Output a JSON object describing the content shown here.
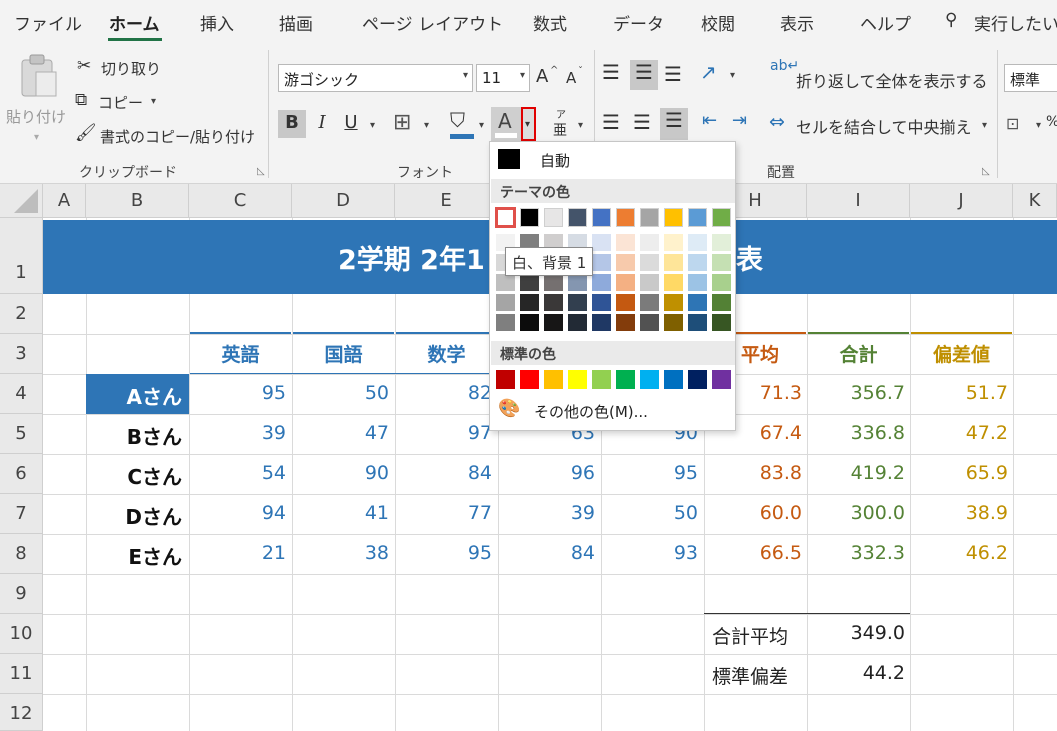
{
  "ribbon_tabs": [
    "ファイル",
    "ホーム",
    "挿入",
    "描画",
    "ページ レイアウト",
    "数式",
    "データ",
    "校閲",
    "表示",
    "ヘルプ"
  ],
  "search_label": "実行したい",
  "clipboard": {
    "paste": "貼り付け",
    "cut": "切り取り",
    "copy": "コピー",
    "format_painter": "書式のコピー/貼り付け",
    "group": "クリップボード"
  },
  "font": {
    "name": "游ゴシック",
    "size": "11",
    "grow": "A",
    "shrink": "A",
    "bold": "B",
    "italic": "I",
    "underline": "U",
    "font_color_glyph": "A",
    "phonetic": "亜",
    "phonetic_top": "ア",
    "group": "フォント"
  },
  "alignment": {
    "wrap_text": "折り返して全体を表示する",
    "merge_center": "セルを結合して中央揃え",
    "group": "配置"
  },
  "number": {
    "format": "標準"
  },
  "color_menu": {
    "automatic": "自動",
    "theme_title": "テーマの色",
    "standard_title": "標準の色",
    "more_colors": "その他の色(M)...",
    "tooltip": "白、背景 1",
    "theme_top": [
      "#ffffff",
      "#000000",
      "#e7e6e6",
      "#44546a",
      "#4472c4",
      "#ed7d31",
      "#a5a5a5",
      "#ffc000",
      "#5b9bd5",
      "#70ad47"
    ],
    "theme_shades": [
      [
        "#f2f2f2",
        "#7f7f7f",
        "#d0cece",
        "#d6dce4",
        "#d9e2f3",
        "#fbe4d5",
        "#ededed",
        "#fff2cc",
        "#deebf6",
        "#e2efd9"
      ],
      [
        "#d8d8d8",
        "#595959",
        "#aeabab",
        "#adb9ca",
        "#b4c6e7",
        "#f7caac",
        "#dbdbdb",
        "#fee599",
        "#bdd7ee",
        "#c5e0b3"
      ],
      [
        "#bfbfbf",
        "#3f3f3f",
        "#757070",
        "#8496b0",
        "#8eaadb",
        "#f4b083",
        "#c9c9c9",
        "#ffd965",
        "#9cc3e5",
        "#a8d08d"
      ],
      [
        "#a5a5a5",
        "#262626",
        "#3a3838",
        "#323f4f",
        "#2f5496",
        "#c45911",
        "#7b7b7b",
        "#bf9000",
        "#2e75b5",
        "#538135"
      ],
      [
        "#7f7f7f",
        "#0c0c0c",
        "#171616",
        "#222a35",
        "#1f3864",
        "#833c0b",
        "#525252",
        "#7f6000",
        "#1e4e79",
        "#375623"
      ]
    ],
    "standard": [
      "#c00000",
      "#ff0000",
      "#ffc000",
      "#ffff00",
      "#92d050",
      "#00b050",
      "#00b0f0",
      "#0070c0",
      "#002060",
      "#7030a0"
    ]
  },
  "columns": [
    "A",
    "B",
    "C",
    "D",
    "E",
    "F",
    "G",
    "H",
    "I",
    "J",
    "K"
  ],
  "rows": [
    "1",
    "2",
    "3",
    "4",
    "5",
    "6",
    "7",
    "8",
    "9",
    "10",
    "11",
    "12"
  ],
  "sheet": {
    "title_left": "2学期 2年1",
    "title_right": "表",
    "headers": [
      "英語",
      "国語",
      "数学",
      "平均",
      "合計",
      "偏差値"
    ],
    "students": [
      {
        "name": "Aさん",
        "scores": [
          "95",
          "50",
          "82",
          "",
          ""
        ],
        "avg": "71.3",
        "total": "356.7",
        "dev": "51.7"
      },
      {
        "name": "Bさん",
        "scores": [
          "39",
          "47",
          "97",
          "63",
          "90"
        ],
        "avg": "67.4",
        "total": "336.8",
        "dev": "47.2"
      },
      {
        "name": "Cさん",
        "scores": [
          "54",
          "90",
          "84",
          "96",
          "95"
        ],
        "avg": "83.8",
        "total": "419.2",
        "dev": "65.9"
      },
      {
        "name": "Dさん",
        "scores": [
          "94",
          "41",
          "77",
          "39",
          "50"
        ],
        "avg": "60.0",
        "total": "300.0",
        "dev": "38.9"
      },
      {
        "name": "Eさん",
        "scores": [
          "21",
          "38",
          "95",
          "84",
          "93"
        ],
        "avg": "66.5",
        "total": "332.3",
        "dev": "46.2"
      }
    ],
    "summary": [
      {
        "label": "合計平均",
        "value": "349.0"
      },
      {
        "label": "標準偏差",
        "value": "44.2"
      }
    ]
  }
}
